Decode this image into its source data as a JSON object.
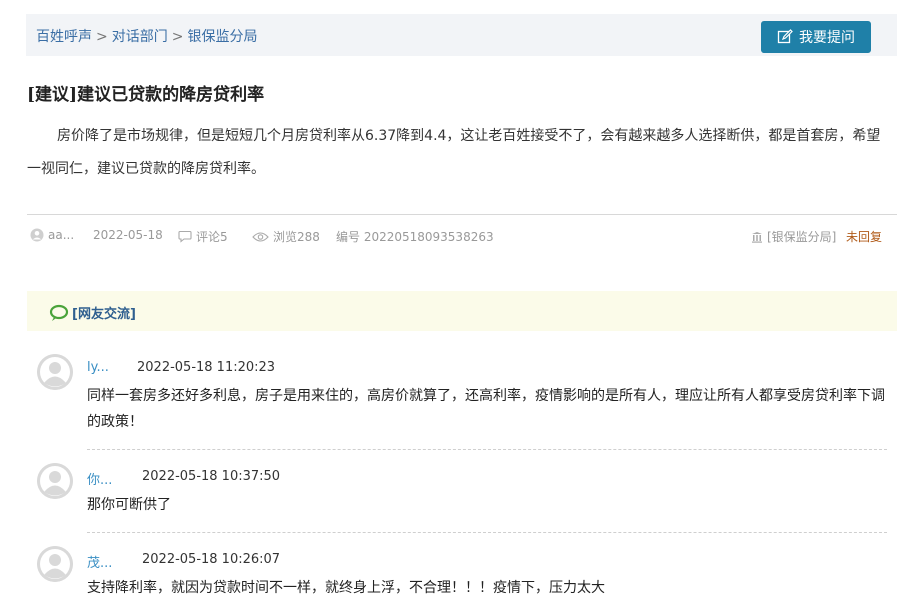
{
  "breadcrumb": {
    "items": [
      "百姓呼声",
      "对话部门",
      "银保监分局"
    ],
    "separator": ">"
  },
  "ask_button": {
    "label": "我要提问"
  },
  "post": {
    "title": "[建议]建议已贷款的降房贷利率",
    "content": "房价降了是市场规律，但是短短几个月房贷利率从6.37降到4.4，这让老百姓接受不了，会有越来越多人选择断供，都是首套房，希望一视同仁，建议已贷款的降房贷利率。",
    "author": "aa...",
    "date": "2022-05-18",
    "comments": "评论5",
    "views": "浏览288",
    "number": "编号 20220518093538263",
    "department": "[银保监分局]",
    "status": "未回复"
  },
  "discussion": {
    "label": "[网友交流]"
  },
  "comments": [
    {
      "user": "ly...",
      "time": "2022-05-18 11:20:23",
      "text": "同样一套房多还好多利息，房子是用来住的，高房价就算了，还高利率，疫情影响的是所有人，理应让所有人都享受房贷利率下调的政策！"
    },
    {
      "user": "你...",
      "time": "2022-05-18 10:37:50",
      "text": "那你可断供了"
    },
    {
      "user": "茂...",
      "time": "2022-05-18 10:26:07",
      "text": "支持降利率，就因为贷款时间不一样，就终身上浮，不合理！！！疫情下，压力太大"
    }
  ],
  "colors": {
    "accent_button": "#1f80a8",
    "link": "#3a6ea5",
    "status": "#b05a18",
    "discussion_bg": "#fbfbe9"
  }
}
